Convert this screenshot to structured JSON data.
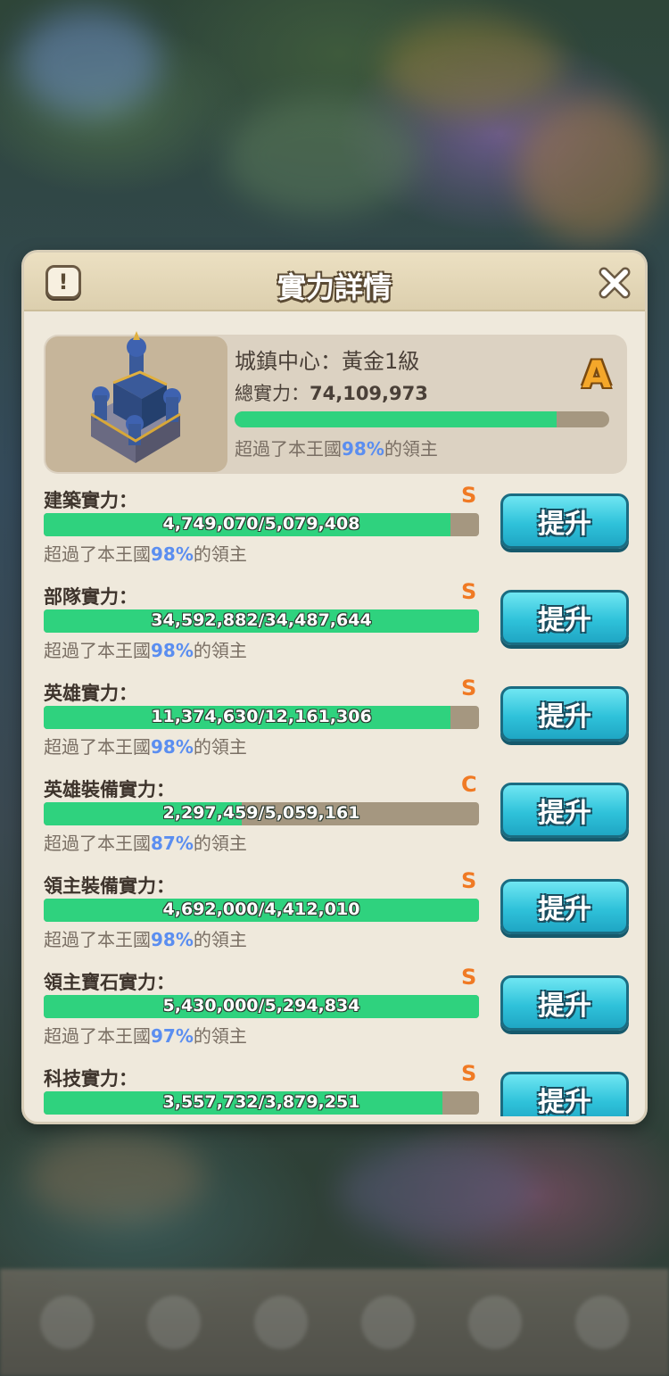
{
  "dialog": {
    "title": "實力詳情",
    "info_icon": "exclamation-icon",
    "close_icon": "close-icon"
  },
  "summary": {
    "name": "城鎮中心：黃金1級",
    "total_label": "總實力：",
    "total_value": "74,109,973",
    "grade": "A",
    "progress": 0.86,
    "note_prefix": "超過了本王國",
    "note_pct": "98%",
    "note_suffix": "的領主",
    "thumb_icon": "castle-icon"
  },
  "rows": [
    {
      "label": "建築實力：",
      "grade": "S",
      "value": "4,749,070/5,079,408",
      "progress": 0.935,
      "note_prefix": "超過了本王國",
      "note_pct": "98%",
      "note_suffix": "的領主",
      "button": "提升"
    },
    {
      "label": "部隊實力：",
      "grade": "S",
      "value": "34,592,882/34,487,644",
      "progress": 1.0,
      "note_prefix": "超過了本王國",
      "note_pct": "98%",
      "note_suffix": "的領主",
      "button": "提升"
    },
    {
      "label": "英雄實力：",
      "grade": "S",
      "value": "11,374,630/12,161,306",
      "progress": 0.935,
      "note_prefix": "超過了本王國",
      "note_pct": "98%",
      "note_suffix": "的領主",
      "button": "提升"
    },
    {
      "label": "英雄裝備實力：",
      "grade": "C",
      "value": "2,297,459/5,059,161",
      "progress": 0.454,
      "note_prefix": "超過了本王國",
      "note_pct": "87%",
      "note_suffix": "的領主",
      "button": "提升"
    },
    {
      "label": "領主裝備實力：",
      "grade": "S",
      "value": "4,692,000/4,412,010",
      "progress": 1.0,
      "note_prefix": "超過了本王國",
      "note_pct": "98%",
      "note_suffix": "的領主",
      "button": "提升"
    },
    {
      "label": "領主寶石實力：",
      "grade": "S",
      "value": "5,430,000/5,294,834",
      "progress": 1.0,
      "note_prefix": "超過了本王國",
      "note_pct": "97%",
      "note_suffix": "的領主",
      "button": "提升"
    },
    {
      "label": "科技實力：",
      "grade": "S",
      "value": "3,557,732/3,879,251",
      "progress": 0.917,
      "note_prefix": "",
      "note_pct": "",
      "note_suffix": "",
      "button": "提升"
    }
  ]
}
